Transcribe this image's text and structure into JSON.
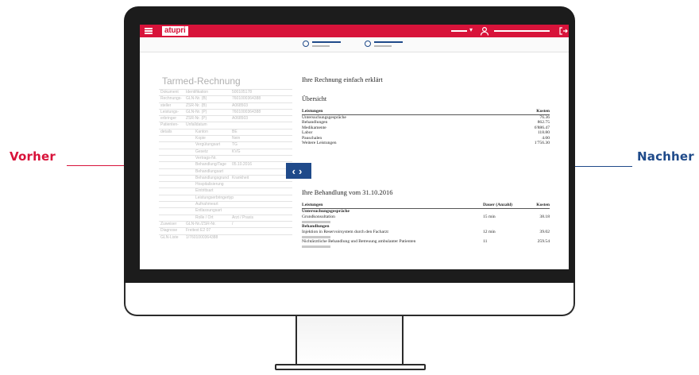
{
  "colors": {
    "brand_red": "#d8133a",
    "brand_blue": "#1f4a8a",
    "bezel": "#1c1c1c"
  },
  "labels": {
    "left": "Vorher",
    "right": "Nachher"
  },
  "app": {
    "logo_text": "atupri",
    "menu_icon": "hamburger-icon",
    "user_icon": "user-icon",
    "logout_icon": "logout-icon"
  },
  "before_panel": {
    "title": "Tarmed-Rechnung",
    "rows": [
      {
        "c1": "Dokument",
        "c2": "Identifikation",
        "c3": "500105178"
      },
      {
        "c1": "Rechnungs-",
        "c2": "GLN-Nr. (B)",
        "c3": "7601000364388"
      },
      {
        "c1": "steller",
        "c2": "ZSR-Nr. (B)",
        "c3": "A068503"
      },
      {
        "c1": "Leistungs-",
        "c2": "GLN-Nr. (P)",
        "c3": "7601000364388"
      },
      {
        "c1": "erbringer",
        "c2": "ZSR-Nr. (P)",
        "c3": "A068503"
      },
      {
        "c1": "Patienten-",
        "c2": "Unfalldatum",
        "c3": ""
      },
      {
        "c1": "details",
        "c2": "Kanton",
        "c3": "BE",
        "indent": true
      },
      {
        "c1": "",
        "c2": "Kopie",
        "c3": "Nein",
        "indent": true
      },
      {
        "c1": "",
        "c2": "Vergütungsart",
        "c3": "TG",
        "indent": true
      },
      {
        "c1": "",
        "c2": "Gesetz",
        "c3": "KVG",
        "indent": true
      },
      {
        "c1": "",
        "c2": "Vertrags-Nr.",
        "c3": "",
        "indent": true
      },
      {
        "c1": "",
        "c2": "Behandlung/Tage",
        "c3": "05.10.2016",
        "indent": true
      },
      {
        "c1": "",
        "c2": "Behandlungsart",
        "c3": "",
        "indent": true
      },
      {
        "c1": "",
        "c2": "Behandlungsgrund",
        "c3": "Krankheit",
        "indent": true
      },
      {
        "c1": "",
        "c2": "Hospitalisierung",
        "c3": "",
        "indent": true
      },
      {
        "c1": "",
        "c2": "Eintrittsart",
        "c3": "",
        "indent": true
      },
      {
        "c1": "",
        "c2": "Leistungserbringertyp",
        "c3": "",
        "indent": true
      },
      {
        "c1": "",
        "c2": "Aufnahmeart",
        "c3": "",
        "indent": true
      },
      {
        "c1": "",
        "c2": "Entlassungsart",
        "c3": "",
        "indent": true
      },
      {
        "c1": "",
        "c2": "Rolle / Ort",
        "c3": "Arzt / Praxis",
        "indent": true
      },
      {
        "c1": "Zuweiser",
        "c2": "GLN-Nr./ZSR-Nr.",
        "c3": "/"
      },
      {
        "c1": "Diagnose",
        "c2": "Freitext    E2    07",
        "c3": ""
      },
      {
        "c1": "GLN-Liste",
        "c2": "1/7601000364388",
        "c3": ""
      }
    ]
  },
  "after_panel": {
    "heading": "Ihre Rechnung einfach erklärt",
    "overview_title": "Übersicht",
    "overview_headers": [
      "Leistungen",
      "Kosten"
    ],
    "overview_rows": [
      [
        "Untersuchungsgespräche",
        "76.36"
      ],
      [
        "Behandlungen",
        "862.75"
      ],
      [
        "Medikamente",
        "6'886.47"
      ],
      [
        "Labor",
        "118.80"
      ],
      [
        "Pauschalen",
        "4.00"
      ],
      [
        "Weitere Leistungen",
        "1'756.30"
      ]
    ],
    "treatment_title": "Ihre Behandlung vom 31.10.2016",
    "treatment_headers": [
      "Leistungen",
      "Dauer (Anzahl)",
      "Kosten"
    ],
    "treatment_rows": [
      {
        "type": "group",
        "c1": "Untersuchungsgespräche"
      },
      {
        "type": "item",
        "c1": "Grundkonsultation",
        "c2": "15 min",
        "c3": "38.18"
      },
      {
        "type": "group",
        "c1": "Behandlungen"
      },
      {
        "type": "item",
        "c1": "Injektion in Reservoirsystem durch den Facharzt",
        "c2": "12 min",
        "c3": "39.02"
      },
      {
        "type": "item",
        "c1": "Nichtärztliche Behandlung und Betreuung ambulanter Patienten",
        "c2": "11",
        "c3": "259.54"
      }
    ]
  }
}
